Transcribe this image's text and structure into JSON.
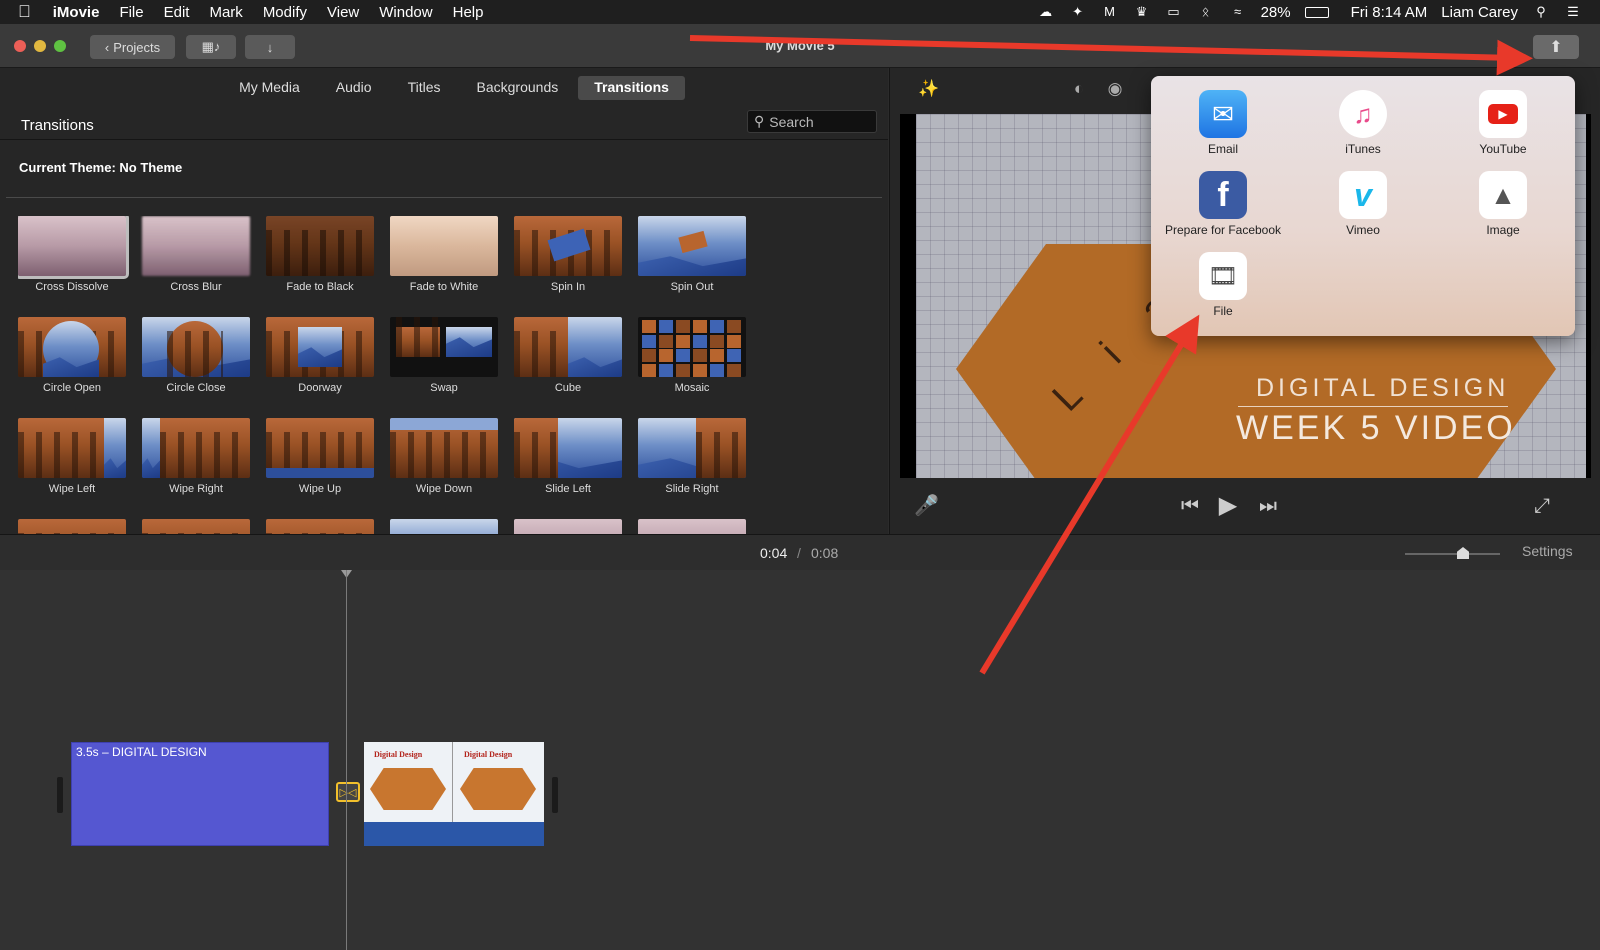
{
  "menubar": {
    "app_name": "iMovie",
    "items": [
      "File",
      "Edit",
      "Mark",
      "Modify",
      "View",
      "Window",
      "Help"
    ],
    "battery": "28%",
    "clock": "Fri 8:14 AM",
    "user": "Liam Carey"
  },
  "titlebar": {
    "projects_label": "Projects",
    "window_title": "My Movie 5"
  },
  "browser": {
    "tabs": [
      {
        "label": "My Media"
      },
      {
        "label": "Audio"
      },
      {
        "label": "Titles"
      },
      {
        "label": "Backgrounds"
      },
      {
        "label": "Transitions",
        "active": true
      }
    ],
    "title": "Transitions",
    "search_placeholder": "Search",
    "theme_label": "Current Theme: No Theme",
    "transitions": [
      "Cross Dissolve",
      "Cross Blur",
      "Fade to Black",
      "Fade to White",
      "Spin In",
      "Spin Out",
      "Circle Open",
      "Circle Close",
      "Doorway",
      "Swap",
      "Cube",
      "Mosaic",
      "Wipe Left",
      "Wipe Right",
      "Wipe Up",
      "Wipe Down",
      "Slide Left",
      "Slide Right"
    ],
    "selected": "Cross Dissolve"
  },
  "viewer": {
    "overlay_title_line1": "DIGITAL DESIGN",
    "overlay_title_line2": "WEEK 5  VIDEO",
    "preview_letters": "L i a"
  },
  "share_menu": {
    "items": [
      {
        "label": "Email",
        "icon": "mail-icon",
        "color": "#1f8fee"
      },
      {
        "label": "iTunes",
        "icon": "music-note-icon",
        "color": "#e94b8b"
      },
      {
        "label": "YouTube",
        "icon": "youtube-icon",
        "color": "#e62117"
      },
      {
        "label": "Prepare for Facebook",
        "icon": "facebook-icon",
        "color": "#3b5ba3"
      },
      {
        "label": "Vimeo",
        "icon": "vimeo-icon",
        "color": "#1ab7ea"
      },
      {
        "label": "Image",
        "icon": "image-icon",
        "color": "#555555"
      },
      {
        "label": "File",
        "icon": "film-strip-icon",
        "color": "#444444"
      }
    ]
  },
  "timeline": {
    "current_time": "0:04",
    "separator": "/",
    "total_time": "0:08",
    "settings_label": "Settings",
    "clip1_label": "3.5s – DIGITAL DESIGN",
    "clip2_title": "Digital Design"
  },
  "colors": {
    "annotation_arrow": "#e8392a",
    "clip1": "#5557d1",
    "transition_marker": "#f2c02c"
  }
}
